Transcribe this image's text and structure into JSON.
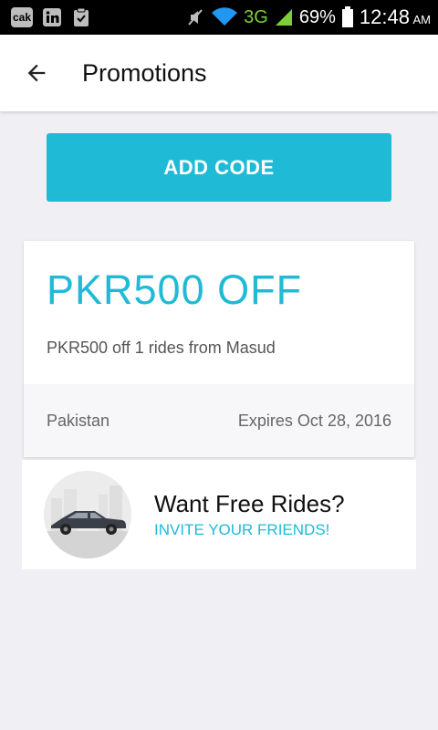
{
  "status_bar": {
    "network": "3G",
    "battery": "69%",
    "time": "12:48",
    "ampm": "AM",
    "app_icons": [
      "cak",
      "linkedin-icon",
      "clipboard-check-icon"
    ]
  },
  "header": {
    "title": "Promotions",
    "back_icon": "arrow-left-icon"
  },
  "add_code": {
    "label": "ADD CODE"
  },
  "promo": {
    "amount": "PKR500 OFF",
    "description": "PKR500 off 1 rides from Masud",
    "country": "Pakistan",
    "expires": "Expires Oct 28, 2016"
  },
  "invite": {
    "title": "Want Free Rides?",
    "link": "INVITE YOUR FRIENDS!"
  },
  "colors": {
    "accent": "#1fbad6",
    "background": "#efeff4"
  }
}
